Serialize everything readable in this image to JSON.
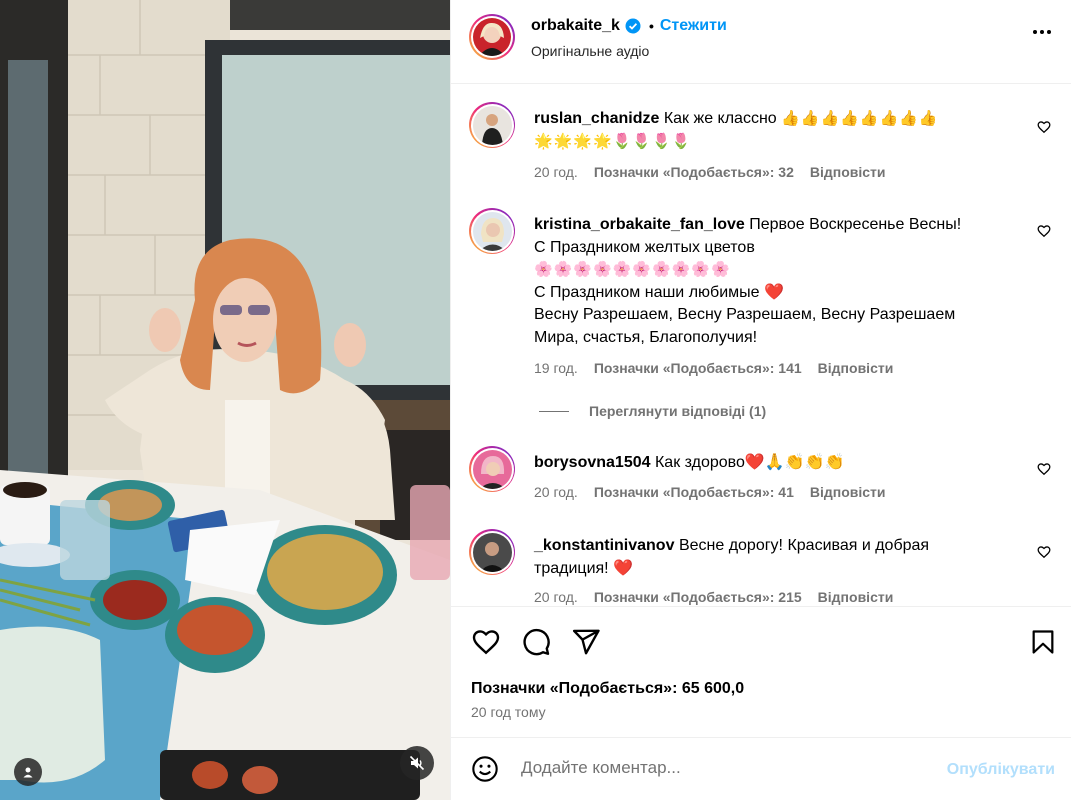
{
  "post": {
    "username": "orbakaite_k",
    "follow_label": "Стежити",
    "separator": "•",
    "audio_label": "Оригінальне аудіо",
    "likes_text": "Позначки «Подобається»: 65 600,0",
    "time_ago": "20 год тому"
  },
  "comments": [
    {
      "username": "ruslan_chanidze",
      "text": "Как же классно",
      "emoji_line1": "👍👍👍👍👍👍👍👍",
      "emoji_line2": "🌟🌟🌟🌟🌷🌷🌷🌷",
      "time": "20 год.",
      "likes": "Позначки «Подобається»: 32",
      "reply_label": "Відповісти"
    },
    {
      "username": "kristina_orbakaite_fan_love",
      "line1": "Первое Воскресенье Весны!",
      "line2": "С Праздником желтых цветов",
      "line3": "🌸🌸🌸🌸🌸🌸🌸🌸🌸🌸",
      "line4": "С Праздником наши любимые ❤️",
      "line5": "Весну Разрешаем, Весну Разрешаем, Весну Разрешаем",
      "line6": "Мира, счастья, Благополучия!",
      "time": "19 год.",
      "likes": "Позначки «Подобається»: 141",
      "reply_label": "Відповісти",
      "view_replies": "Переглянути відповіді (1)"
    },
    {
      "username": "borysovna1504",
      "text": "Как здорово❤️🙏👏👏👏",
      "time": "20 год.",
      "likes": "Позначки «Подобається»: 41",
      "reply_label": "Відповісти"
    },
    {
      "username": "_konstantinivanov",
      "text": "Весне дорогу! Красивая и добрая",
      "text_line2": "традиция! ❤️",
      "time": "20 год.",
      "likes": "Позначки «Подобається»: 215",
      "reply_label": "Відповісти"
    }
  ],
  "add_comment": {
    "placeholder": "Додайте коментар...",
    "post_label": "Опублікувати"
  },
  "colors": {
    "accent": "#0095f6",
    "post_disabled": "#b2dffc",
    "secondary_text": "#737373",
    "border": "#efefef"
  },
  "icons": [
    "verified-icon",
    "more-options-icon",
    "heart-icon",
    "comment-icon",
    "share-icon",
    "bookmark-icon",
    "emoji-icon",
    "user-tag-icon",
    "mute-icon"
  ]
}
